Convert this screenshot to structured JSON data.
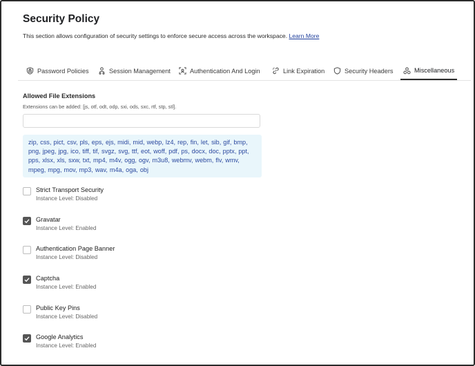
{
  "page": {
    "title": "Security Policy",
    "description": "This section allows configuration of security settings to enforce secure access across the workspace.",
    "learn_more": "Learn More"
  },
  "tabs": [
    {
      "label": "Password Policies",
      "icon": "shield-lock-icon",
      "active": false
    },
    {
      "label": "Session Management",
      "icon": "users-icon",
      "active": false
    },
    {
      "label": "Authentication And Login",
      "icon": "face-scan-icon",
      "active": false
    },
    {
      "label": "Link Expiration",
      "icon": "link-break-icon",
      "active": false
    },
    {
      "label": "Security Headers",
      "icon": "shield-icon",
      "active": false
    },
    {
      "label": "Miscellaneous",
      "icon": "shapes-icon",
      "active": true
    }
  ],
  "file_extensions": {
    "label": "Allowed File Extensions",
    "hint": "Extensions can be added: [js, otf, odt, odp, sxi, ods, sxc, rtf, stp, stl].",
    "input_value": "",
    "allowed_list": "zip, css, pict, csv, pls, eps, ejs, midi, mid, webp, lz4, rep, fin, let, sib, gif, bmp, png, jpeg, jpg, ico, tiff, tif, svgz, svg, ttf, eot, woff, pdf, ps, docx, doc, pptx, ppt, pps, xlsx, xls, sxw, txt, mp4, m4v, ogg, ogv, m3u8, webmv, webm, flv, wmv, mpeg, mpg, mov, mp3, wav, m4a, oga, obj"
  },
  "options": [
    {
      "title": "Strict Transport Security",
      "subtitle": "Instance Level: Disabled",
      "checked": false
    },
    {
      "title": "Gravatar",
      "subtitle": "Instance Level: Enabled",
      "checked": true
    },
    {
      "title": "Authentication Page Banner",
      "subtitle": "Instance Level: Disabled",
      "checked": false
    },
    {
      "title": "Captcha",
      "subtitle": "Instance Level: Enabled",
      "checked": true
    },
    {
      "title": "Public Key Pins",
      "subtitle": "Instance Level: Disabled",
      "checked": false
    },
    {
      "title": "Google Analytics",
      "subtitle": "Instance Level: Enabled",
      "checked": true
    }
  ]
}
